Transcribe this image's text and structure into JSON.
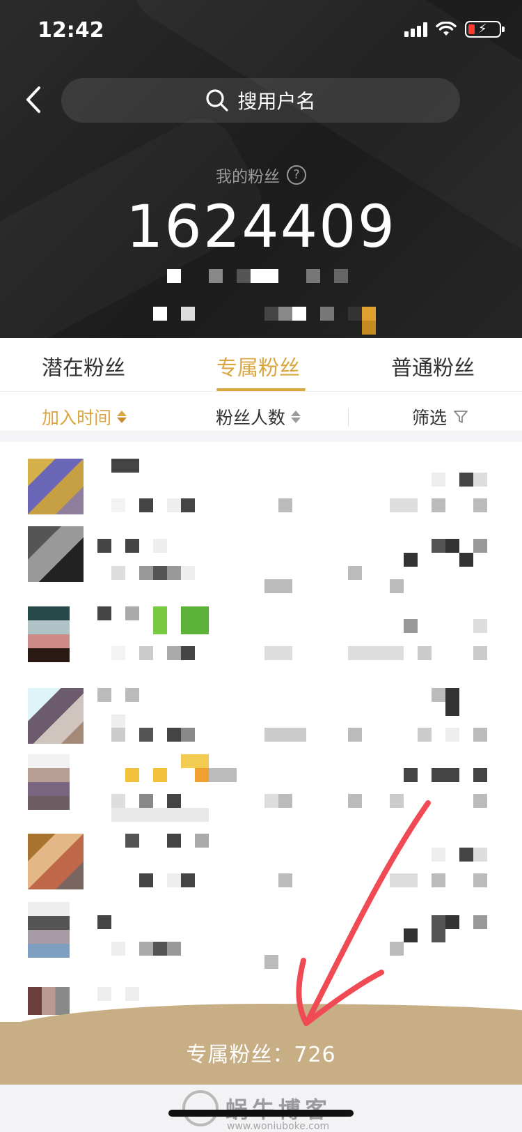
{
  "status_bar": {
    "time": "12:42"
  },
  "search": {
    "label": "搜用户名"
  },
  "fans": {
    "caption": "我的粉丝",
    "count": "1624409",
    "help_symbol": "?"
  },
  "tabs": [
    {
      "label": "潜在粉丝",
      "active": false
    },
    {
      "label": "专属粉丝",
      "active": true
    },
    {
      "label": "普通粉丝",
      "active": false
    }
  ],
  "sort": {
    "join_time": "加入时间",
    "fan_count": "粉丝人数",
    "filter": "筛选"
  },
  "footer": {
    "label": "专属粉丝：",
    "value": "726"
  },
  "watermark": {
    "text": "蜗牛博客",
    "url": "www.woniuboke.com"
  },
  "colors": {
    "accent": "#d9a640",
    "header_bg": "#222222",
    "footer_bg": "#c7ae84",
    "annotation": "#f04a55"
  },
  "icons": [
    "back-chevron-icon",
    "search-icon",
    "help-icon",
    "sort-arrows-icon",
    "filter-icon",
    "signal-icon",
    "wifi-icon",
    "battery-icon"
  ]
}
